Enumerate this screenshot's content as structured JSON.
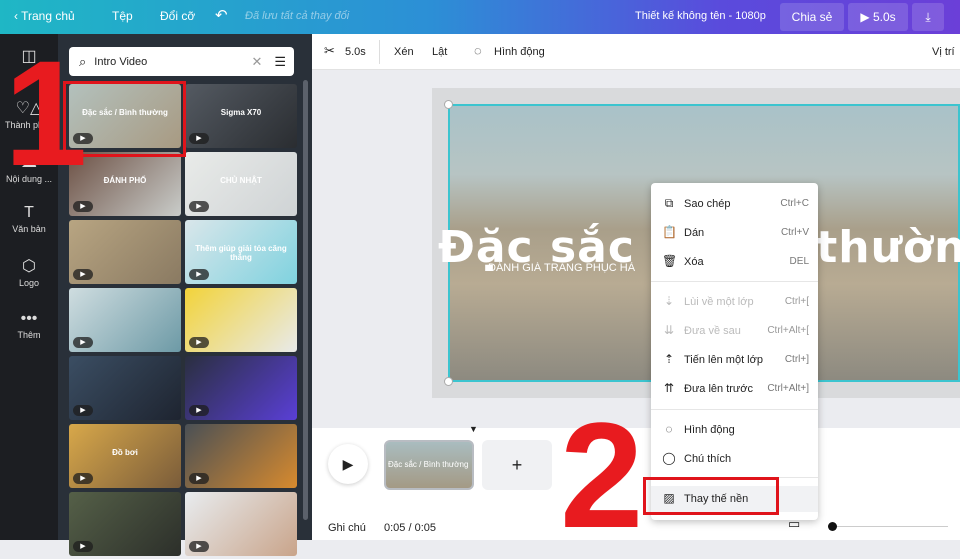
{
  "topbar": {
    "home": "Trang chủ",
    "file": "Tệp",
    "resize": "Đổi cỡ",
    "saved": "Đã lưu tất cả thay đổi",
    "title": "Thiết kế không tên - 1080p",
    "share": "Chia sẻ",
    "play_duration": "5.0s"
  },
  "rail": [
    {
      "label": "Thành phần"
    },
    {
      "label": "Nội dung ..."
    },
    {
      "label": "Văn bản"
    },
    {
      "label": "Logo"
    },
    {
      "label": "Thêm"
    }
  ],
  "search": {
    "value": "Intro Video"
  },
  "thumbs": [
    {
      "text": "Đặc sắc / Bình thường",
      "c1": "#b3c1bd",
      "c2": "#a89a82"
    },
    {
      "text": "Sigma X70",
      "c1": "#545a62",
      "c2": "#2a2d31"
    },
    {
      "text": "ĐÁNH PHỐ",
      "c1": "#6d5145",
      "c2": "#c9ccc9"
    },
    {
      "text": "CHỦ NHẬT",
      "c1": "#e9ebe9",
      "c2": "#cfd3d5"
    },
    {
      "text": "",
      "c1": "#b8a582",
      "c2": "#8a7a62"
    },
    {
      "text": "Thêm giúp giải tỏa căng thẳng",
      "c1": "#d9e6ea",
      "c2": "#7fd2df"
    },
    {
      "text": "",
      "c1": "#cfdde0",
      "c2": "#6d9aa6"
    },
    {
      "text": "",
      "c1": "#f2d33a",
      "c2": "#e8eaea"
    },
    {
      "text": "",
      "c1": "#3b4e63",
      "c2": "#1e2430"
    },
    {
      "text": "",
      "c1": "#2a2f3f",
      "c2": "#5a3fd6"
    },
    {
      "text": "Đồ bơi",
      "c1": "#d8a84a",
      "c2": "#7a5c3a"
    },
    {
      "text": "",
      "c1": "#4a5055",
      "c2": "#d78a2e"
    },
    {
      "text": "",
      "c1": "#556048",
      "c2": "#2c2f2a"
    },
    {
      "text": "",
      "c1": "#e8ecef",
      "c2": "#c9a48a"
    }
  ],
  "toolbar": {
    "duration": "5.0s",
    "crop": "Xén",
    "flip": "Lật",
    "animate": "Hình động",
    "position": "Vị trí"
  },
  "canvas": {
    "headline": "Đặc sắc / Bình thường",
    "subline": "ĐÁNH GIÁ TRANG PHỤC HÀ"
  },
  "timeline": {
    "notes": "Ghi chú",
    "time": "0:05 / 0:05",
    "clip_text": "Đặc sắc / Bình thường",
    "add": "+"
  },
  "menu": [
    {
      "label": "Sao chép",
      "shortcut": "Ctrl+C",
      "icon": "⧉"
    },
    {
      "label": "Dán",
      "shortcut": "Ctrl+V",
      "icon": "📋"
    },
    {
      "label": "Xóa",
      "shortcut": "DEL",
      "icon": "🗑"
    },
    {
      "label": "Lùi về một lớp",
      "shortcut": "Ctrl+[",
      "icon": "⇣"
    },
    {
      "label": "Đưa về sau",
      "shortcut": "Ctrl+Alt+[",
      "icon": "⇊"
    },
    {
      "label": "Tiến lên một lớp",
      "shortcut": "Ctrl+]",
      "icon": "⇡"
    },
    {
      "label": "Đưa lên trước",
      "shortcut": "Ctrl+Alt+]",
      "icon": "⇈"
    },
    {
      "label": "Hình động",
      "shortcut": "",
      "icon": "◌"
    },
    {
      "label": "Chú thích",
      "shortcut": "",
      "icon": "◯"
    },
    {
      "label": "Thay thế nền",
      "shortcut": "",
      "icon": "▨"
    }
  ],
  "annotations": {
    "step1": "1",
    "step2": "2"
  }
}
